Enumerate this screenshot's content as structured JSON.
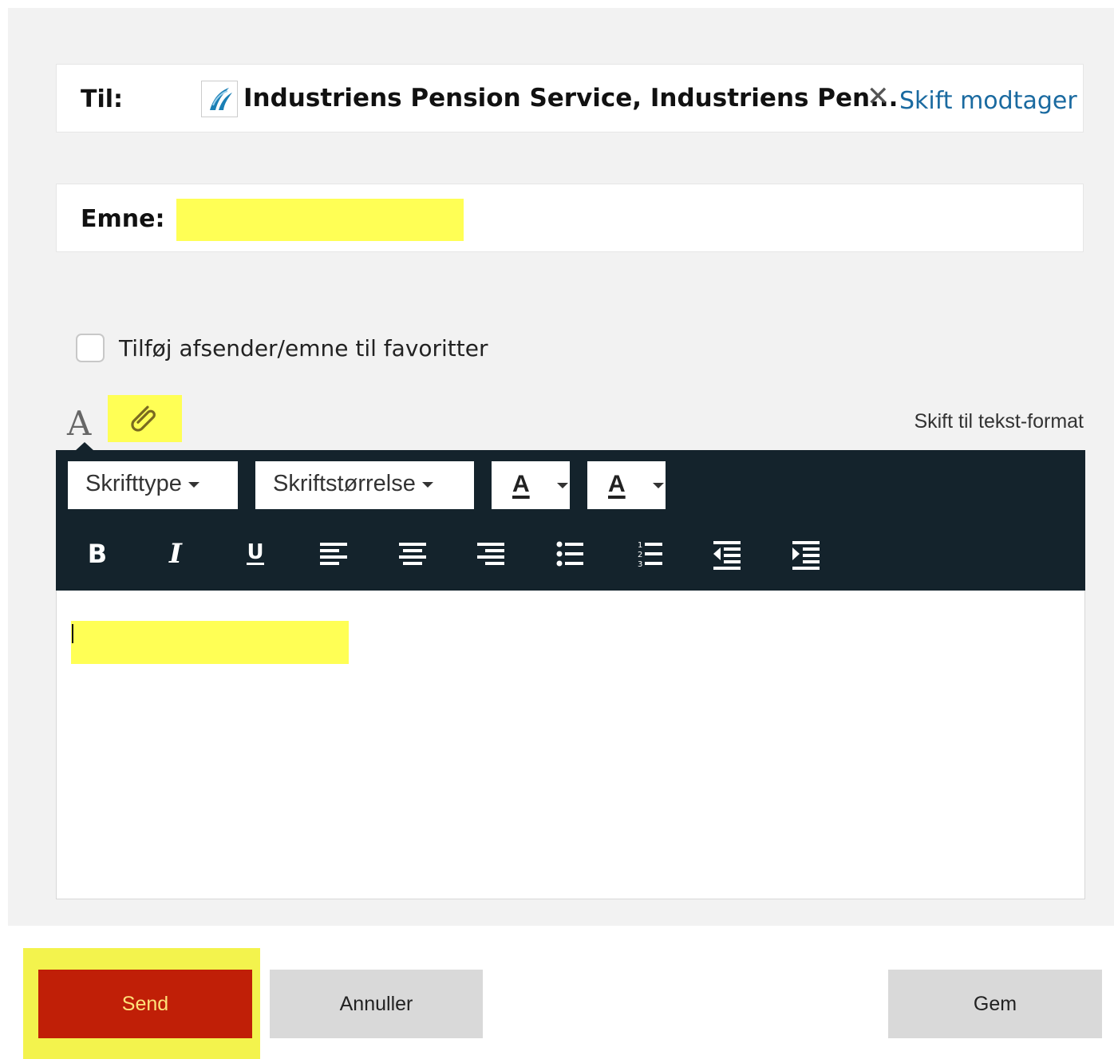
{
  "recipient": {
    "label": "Til:",
    "name": "Industriens Pension Service, Industriens Pen...",
    "remove_icon": "close-icon",
    "change_label": "Skift modtager"
  },
  "subject": {
    "label": "Emne:",
    "value": ""
  },
  "favorites": {
    "label": "Tilføj afsender/emne til favoritter",
    "checked": false
  },
  "editor_tabs": {
    "font_icon": "A",
    "attach_icon": "paperclip-icon",
    "switch_format_label": "Skift til tekst-format"
  },
  "toolbar": {
    "font_type_label": "Skrifttype",
    "font_size_label": "Skriftstørrelse",
    "text_color_label": "A",
    "highlight_color_label": "A",
    "format_buttons": [
      "bold",
      "italic",
      "underline",
      "align-left",
      "align-center",
      "align-right",
      "bullet-list",
      "numbered-list",
      "outdent",
      "indent"
    ]
  },
  "body": {
    "value": ""
  },
  "actions": {
    "send_label": "Send",
    "cancel_label": "Annuller",
    "save_label": "Gem"
  },
  "colors": {
    "send_bg": "#c01f07",
    "send_text": "#ffe27a",
    "toolbar_bg": "#14232c",
    "highlight": "#ffff55",
    "link": "#1a6aa0"
  }
}
